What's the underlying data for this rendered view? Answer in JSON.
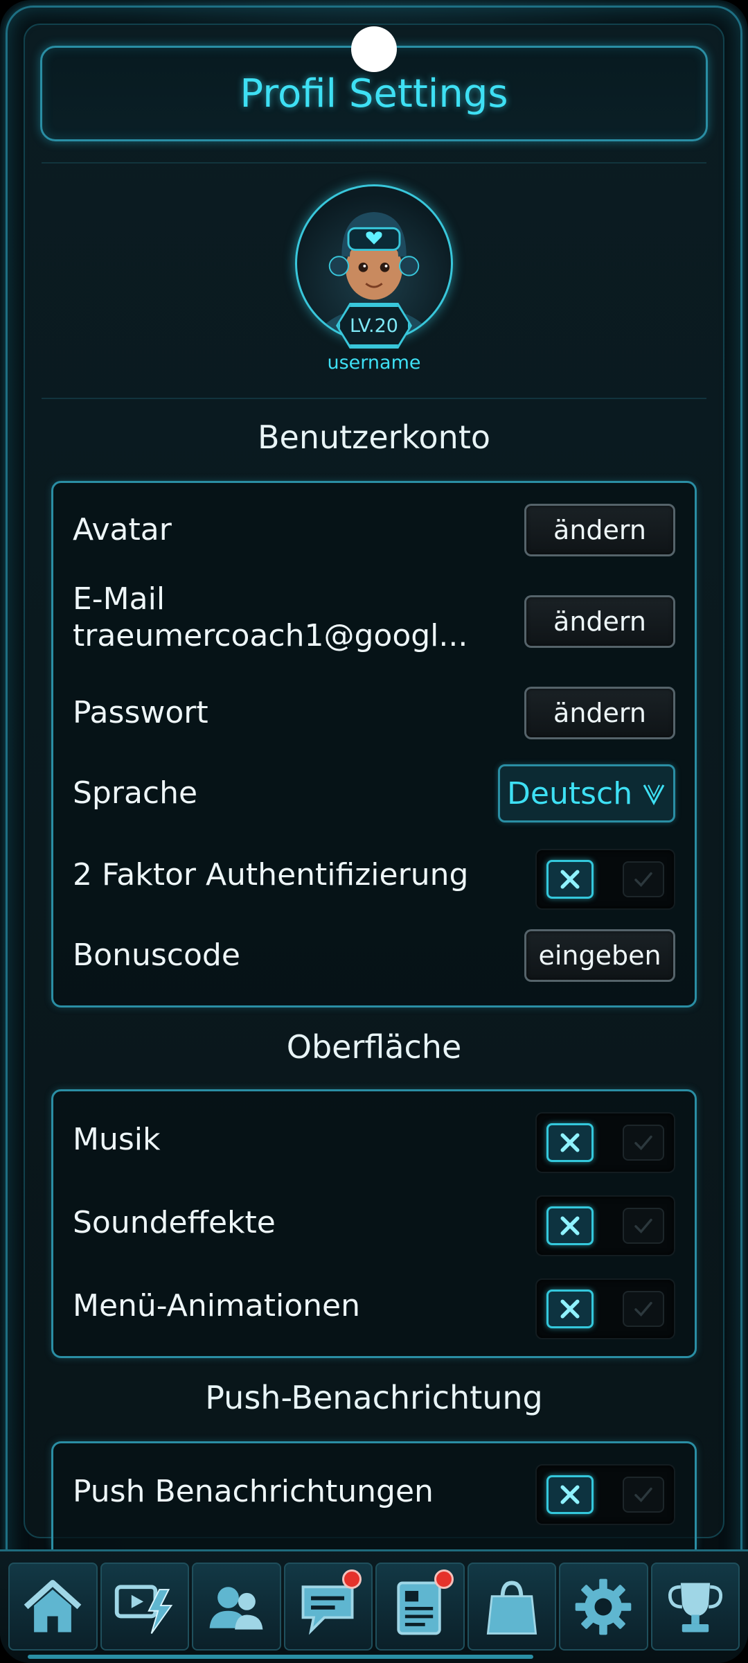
{
  "header": {
    "title": "Profil Settings"
  },
  "profile": {
    "level": "LV.20",
    "username": "username"
  },
  "sections": {
    "account": {
      "title": "Benutzerkonto",
      "avatar": {
        "label": "Avatar",
        "button": "ändern"
      },
      "email": {
        "label": "E-Mail",
        "value": "traeumercoach1@googl...",
        "button": "ändern"
      },
      "password": {
        "label": "Passwort",
        "button": "ändern"
      },
      "language": {
        "label": "Sprache",
        "selected": "Deutsch"
      },
      "two_factor": {
        "label": "2 Faktor Authentifizierung",
        "state": "off"
      },
      "bonus": {
        "label": "Bonuscode",
        "button": "eingeben"
      }
    },
    "interface": {
      "title": "Oberfläche",
      "music": {
        "label": "Musik",
        "state": "off"
      },
      "sfx": {
        "label": "Soundeffekte",
        "state": "off"
      },
      "animations": {
        "label": "Menü-Animationen",
        "state": "off"
      }
    },
    "push": {
      "title": "Push-Benachrichtung",
      "push": {
        "label": "Push Benachrichtungen",
        "state": "off"
      }
    }
  },
  "tabbar": {
    "items": [
      {
        "icon": "home-icon"
      },
      {
        "icon": "video-lightning-icon"
      },
      {
        "icon": "friends-icon"
      },
      {
        "icon": "chat-icon",
        "notification": true
      },
      {
        "icon": "news-icon",
        "notification": true
      },
      {
        "icon": "shop-bag-icon"
      },
      {
        "icon": "settings-gear-icon"
      },
      {
        "icon": "trophy-icon"
      }
    ]
  },
  "colors": {
    "accent": "#3ee0f4",
    "border": "#2a8ea4",
    "notification": "#e5322b"
  }
}
